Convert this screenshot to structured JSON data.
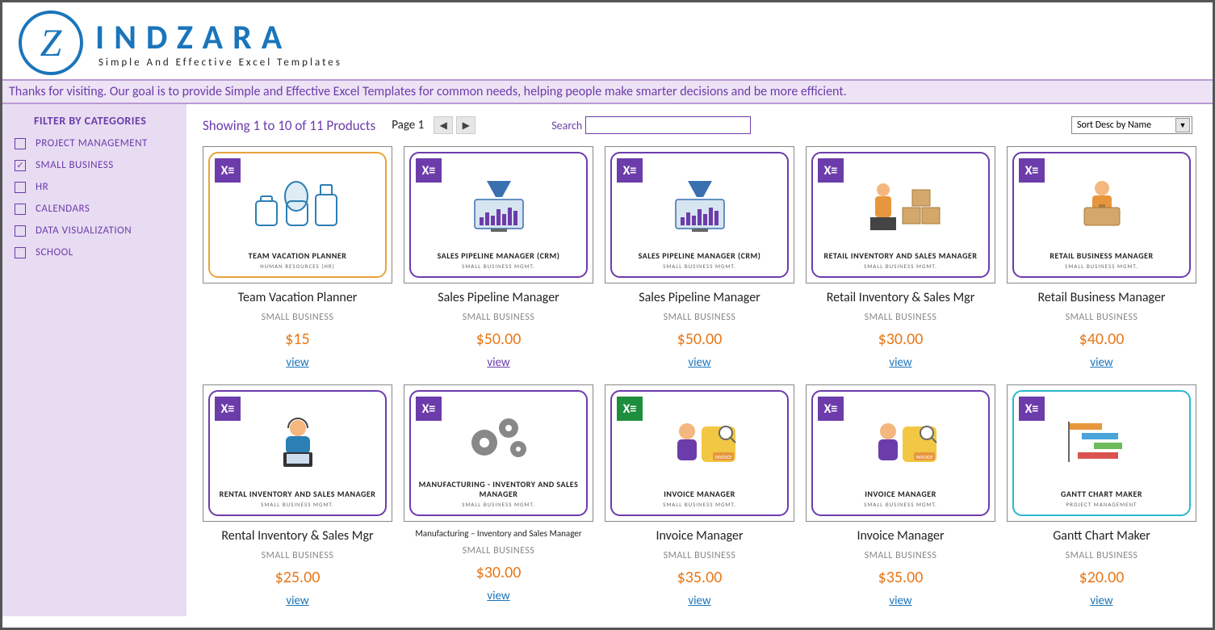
{
  "logo": {
    "main": "INDZARA",
    "sub": "Simple And Effective Excel Templates"
  },
  "banner": "Thanks for visiting. Our goal is to provide Simple and Effective Excel Templates for common needs, helping people make smarter decisions and be more efficient.",
  "sidebar": {
    "title": "FILTER BY CATEGORIES",
    "items": [
      {
        "label": "PROJECT MANAGEMENT",
        "checked": false
      },
      {
        "label": "SMALL BUSINESS",
        "checked": true
      },
      {
        "label": "HR",
        "checked": false
      },
      {
        "label": "CALENDARS",
        "checked": false
      },
      {
        "label": "DATA VISUALIZATION",
        "checked": false
      },
      {
        "label": "SCHOOL",
        "checked": false
      }
    ]
  },
  "toolbar": {
    "results": "Showing 1 to 10 of 11 Products",
    "page_label": "Page 1",
    "search_label": "Search",
    "search_value": "",
    "sort_value": "Sort Desc by Name"
  },
  "products": [
    {
      "title": "Team Vacation Planner",
      "category": "SMALL BUSINESS",
      "price": "$15",
      "view": "view",
      "thumb_title": "TEAM VACATION PLANNER",
      "thumb_sub": "HUMAN RESOURCES (HR)",
      "border": "orange",
      "art": "luggage"
    },
    {
      "title": "Sales Pipeline Manager",
      "category": "SMALL BUSINESS",
      "price": "$50.00",
      "view": "view",
      "view_visited": true,
      "thumb_title": "SALES PIPELINE MANAGER (CRM)",
      "thumb_sub": "SMALL BUSINESS MGMT.",
      "border": "purple",
      "art": "funnel"
    },
    {
      "title": "Sales Pipeline Manager",
      "category": "SMALL BUSINESS",
      "price": "$50.00",
      "view": "view",
      "thumb_title": "SALES PIPELINE MANAGER (CRM)",
      "thumb_sub": "SMALL BUSINESS MGMT.",
      "border": "purple",
      "art": "funnel"
    },
    {
      "title": "Retail Inventory & Sales Mgr",
      "category": "SMALL BUSINESS",
      "price": "$30.00",
      "view": "view",
      "thumb_title": "RETAIL INVENTORY AND SALES MANAGER",
      "thumb_sub": "SMALL BUSINESS MGMT.",
      "border": "purple",
      "art": "boxes"
    },
    {
      "title": "Retail Business Manager",
      "category": "SMALL BUSINESS",
      "price": "$40.00",
      "view": "view",
      "thumb_title": "RETAIL BUSINESS MANAGER",
      "thumb_sub": "SMALL BUSINESS MGMT.",
      "border": "purple",
      "art": "carry"
    },
    {
      "title": "Rental Inventory & Sales Mgr",
      "category": "SMALL BUSINESS",
      "price": "$25.00",
      "view": "view",
      "thumb_title": "RENTAL INVENTORY AND SALES MANAGER",
      "thumb_sub": "SMALL BUSINESS MGMT.",
      "border": "purple",
      "art": "agent"
    },
    {
      "title": "Manufacturing – Inventory and Sales Manager",
      "title_small": true,
      "category": "SMALL BUSINESS",
      "price": "$30.00",
      "view": "view",
      "thumb_title": "MANUFACTURING - INVENTORY AND SALES MANAGER",
      "thumb_sub": "SMALL BUSINESS MGMT.",
      "border": "purple",
      "art": "gears"
    },
    {
      "title": "Invoice Manager",
      "category": "SMALL BUSINESS",
      "price": "$35.00",
      "view": "view",
      "thumb_title": "INVOICE MANAGER",
      "thumb_sub": "SMALL BUSINESS MGMT.",
      "border": "purple",
      "badge": "green",
      "art": "invoice"
    },
    {
      "title": "Invoice Manager",
      "category": "SMALL BUSINESS",
      "price": "$35.00",
      "view": "view",
      "thumb_title": "INVOICE MANAGER",
      "thumb_sub": "SMALL BUSINESS MGMT.",
      "border": "purple",
      "art": "invoice"
    },
    {
      "title": "Gantt Chart Maker",
      "category": "SMALL BUSINESS",
      "price": "$20.00",
      "view": "view",
      "thumb_title": "GANTT CHART MAKER",
      "thumb_sub": "PROJECT MANAGEMENT",
      "border": "teal",
      "art": "gantt"
    }
  ]
}
